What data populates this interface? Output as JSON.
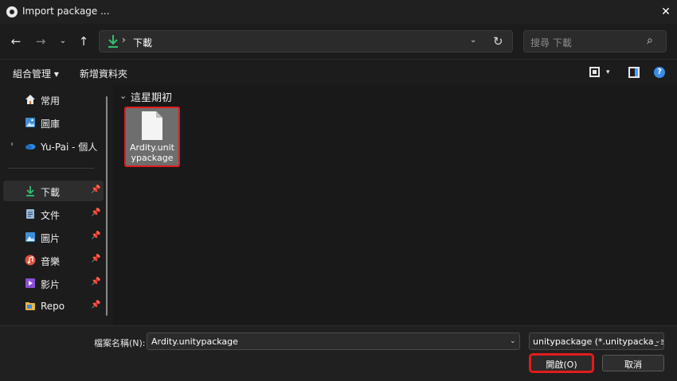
{
  "window": {
    "title": "Import package ...",
    "close_icon": "close-icon"
  },
  "navigation": {
    "back_icon": "arrow-left-icon",
    "forward_icon": "arrow-right-icon",
    "recent_icon": "chevron-down-icon",
    "up_icon": "arrow-up-icon",
    "address": {
      "icon": "download-icon",
      "separator": "›",
      "path": "下載",
      "dropdown_icon": "chevron-down-icon",
      "refresh_icon": "refresh-icon"
    },
    "search": {
      "placeholder": "搜尋 下載",
      "icon": "search-icon"
    }
  },
  "toolbar": {
    "organize_label": "組合管理 ▾",
    "new_folder_label": "新增資料夾",
    "view_icon": "view-layout-icon",
    "preview_icon": "preview-pane-icon",
    "help_icon": "help-icon",
    "help_text": "?"
  },
  "sidebar": {
    "items": [
      {
        "label": "常用",
        "icon": "home-icon",
        "pinned": false
      },
      {
        "label": "圖庫",
        "icon": "gallery-icon",
        "pinned": false
      },
      {
        "label": "Yu-Pai - 個人",
        "icon": "onedrive-icon",
        "pinned": false,
        "expandable": true
      },
      {
        "label": "下載",
        "icon": "download-icon",
        "pinned": true,
        "active": true
      },
      {
        "label": "文件",
        "icon": "document-icon",
        "pinned": true
      },
      {
        "label": "圖片",
        "icon": "pictures-icon",
        "pinned": true
      },
      {
        "label": "音樂",
        "icon": "music-icon",
        "pinned": true
      },
      {
        "label": "影片",
        "icon": "video-icon",
        "pinned": true
      },
      {
        "label": "Repo",
        "icon": "folder-icon",
        "pinned": true
      }
    ],
    "pin_glyph": "📌"
  },
  "content": {
    "group_title": "這星期初",
    "files": [
      {
        "name": "Ardity.unitypackage",
        "icon": "file-icon",
        "selected": true
      }
    ]
  },
  "footer": {
    "filename_label": "檔案名稱(N):",
    "filename_value": "Ardity.unitypackage",
    "filetype_value": "unitypackage (*.unitypackage",
    "open_label": "開啟(O)",
    "cancel_label": "取消"
  },
  "colors": {
    "background": "#1c1c1c",
    "highlight": "#e41b1b",
    "accent": "#3a8ee6",
    "download_accent": "#2fbf71"
  }
}
